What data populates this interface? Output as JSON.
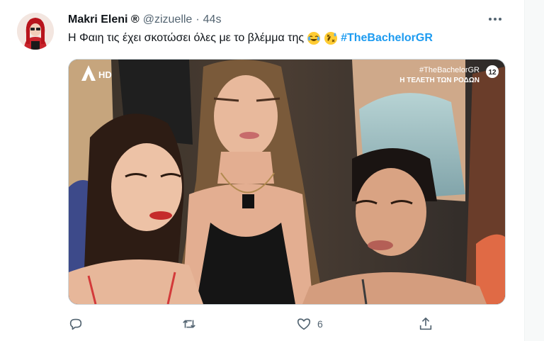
{
  "tweet": {
    "display_name": "Makri Eleni ®",
    "handle": "@zizuelle",
    "separator": "·",
    "time": "44s",
    "text": "Η Φαιη τις έχει σκοτώσει όλες με το βλέμμα της",
    "emojis": [
      "tears-of-joy-emoji",
      "rolling-on-floor-laughing-emoji"
    ],
    "hashtag": "#TheBachelorGR"
  },
  "media": {
    "channel_logo": "AHD",
    "overlay_hashtag": "#TheBachelorGR",
    "overlay_subtitle": "Η ΤΕΛΕΤΗ ΤΩΝ ΡΟΔΩΝ",
    "rating_badge": "12"
  },
  "actions": {
    "reply_count": "",
    "retweet_count": "",
    "like_count": "6",
    "icons": [
      "reply-icon",
      "retweet-icon",
      "like-icon",
      "share-icon"
    ]
  },
  "colors": {
    "text": "#0f1419",
    "muted": "#536471",
    "hashtag": "#1d9bf0"
  }
}
